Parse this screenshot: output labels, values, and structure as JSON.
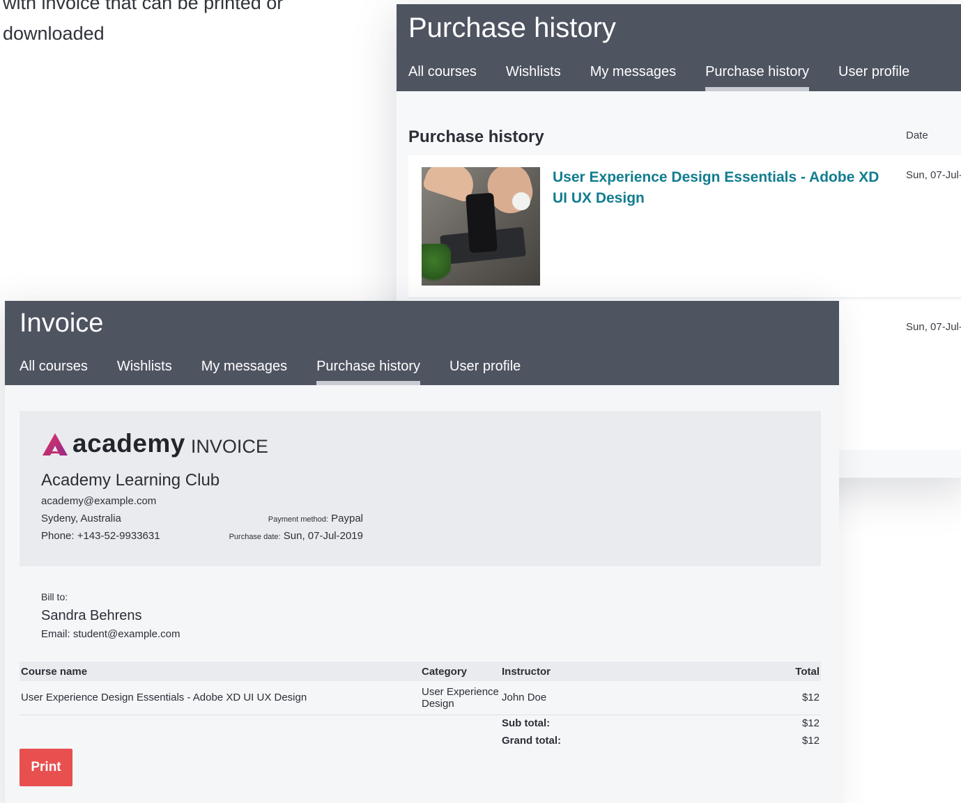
{
  "caption": {
    "line1": "with invoice that can be printed or",
    "line2": "downloaded"
  },
  "purchase_window": {
    "title": "Purchase history",
    "tabs": [
      {
        "label": "All courses",
        "active": false
      },
      {
        "label": "Wishlists",
        "active": false
      },
      {
        "label": "My messages",
        "active": false
      },
      {
        "label": "Purchase history",
        "active": true
      },
      {
        "label": "User profile",
        "active": false
      }
    ],
    "section_title": "Purchase history",
    "date_header": "Date",
    "rows": [
      {
        "course": "User Experience Design Essentials - Adobe XD UI UX Design",
        "date": "Sun, 07-Jul-",
        "thumbnail": "course-thumbnail-phone-desk"
      },
      {
        "course": "",
        "date": "Sun, 07-Jul-"
      }
    ]
  },
  "invoice_window": {
    "title": "Invoice",
    "tabs": [
      {
        "label": "All courses",
        "active": false
      },
      {
        "label": "Wishlists",
        "active": false
      },
      {
        "label": "My messages",
        "active": false
      },
      {
        "label": "Purchase history",
        "active": true
      },
      {
        "label": "User profile",
        "active": false
      }
    ],
    "brand": {
      "name": "academy",
      "doc_type": "INVOICE",
      "accent_start": "#e8335d",
      "accent_end": "#8e2a8f"
    },
    "company": {
      "name": "Academy Learning Club",
      "email": "academy@example.com",
      "address": "Sydeny, Australia",
      "phone": "Phone: +143-52-9933631"
    },
    "meta": {
      "payment_label": "Payment method:",
      "payment_value": "Paypal",
      "date_label": "Purchase date:",
      "date_value": "Sun, 07-Jul-2019"
    },
    "bill_to": {
      "label": "Bill to:",
      "name": "Sandra Behrens",
      "email": "Email: student@example.com"
    },
    "table": {
      "headers": {
        "course": "Course name",
        "category": "Category",
        "instructor": "Instructor",
        "total": "Total"
      },
      "items": [
        {
          "course": "User Experience Design Essentials - Adobe XD UI UX Design",
          "category": "User Experience Design",
          "instructor": "John Doe",
          "total": "$12"
        }
      ],
      "subtotal_label": "Sub total:",
      "subtotal_value": "$12",
      "grandtotal_label": "Grand total:",
      "grandtotal_value": "$12"
    },
    "print_label": "Print",
    "print_color": "#e84f4f"
  },
  "colors": {
    "header_bg": "#4f5461",
    "link": "#117d8f",
    "card_bg": "#e9ebef"
  }
}
